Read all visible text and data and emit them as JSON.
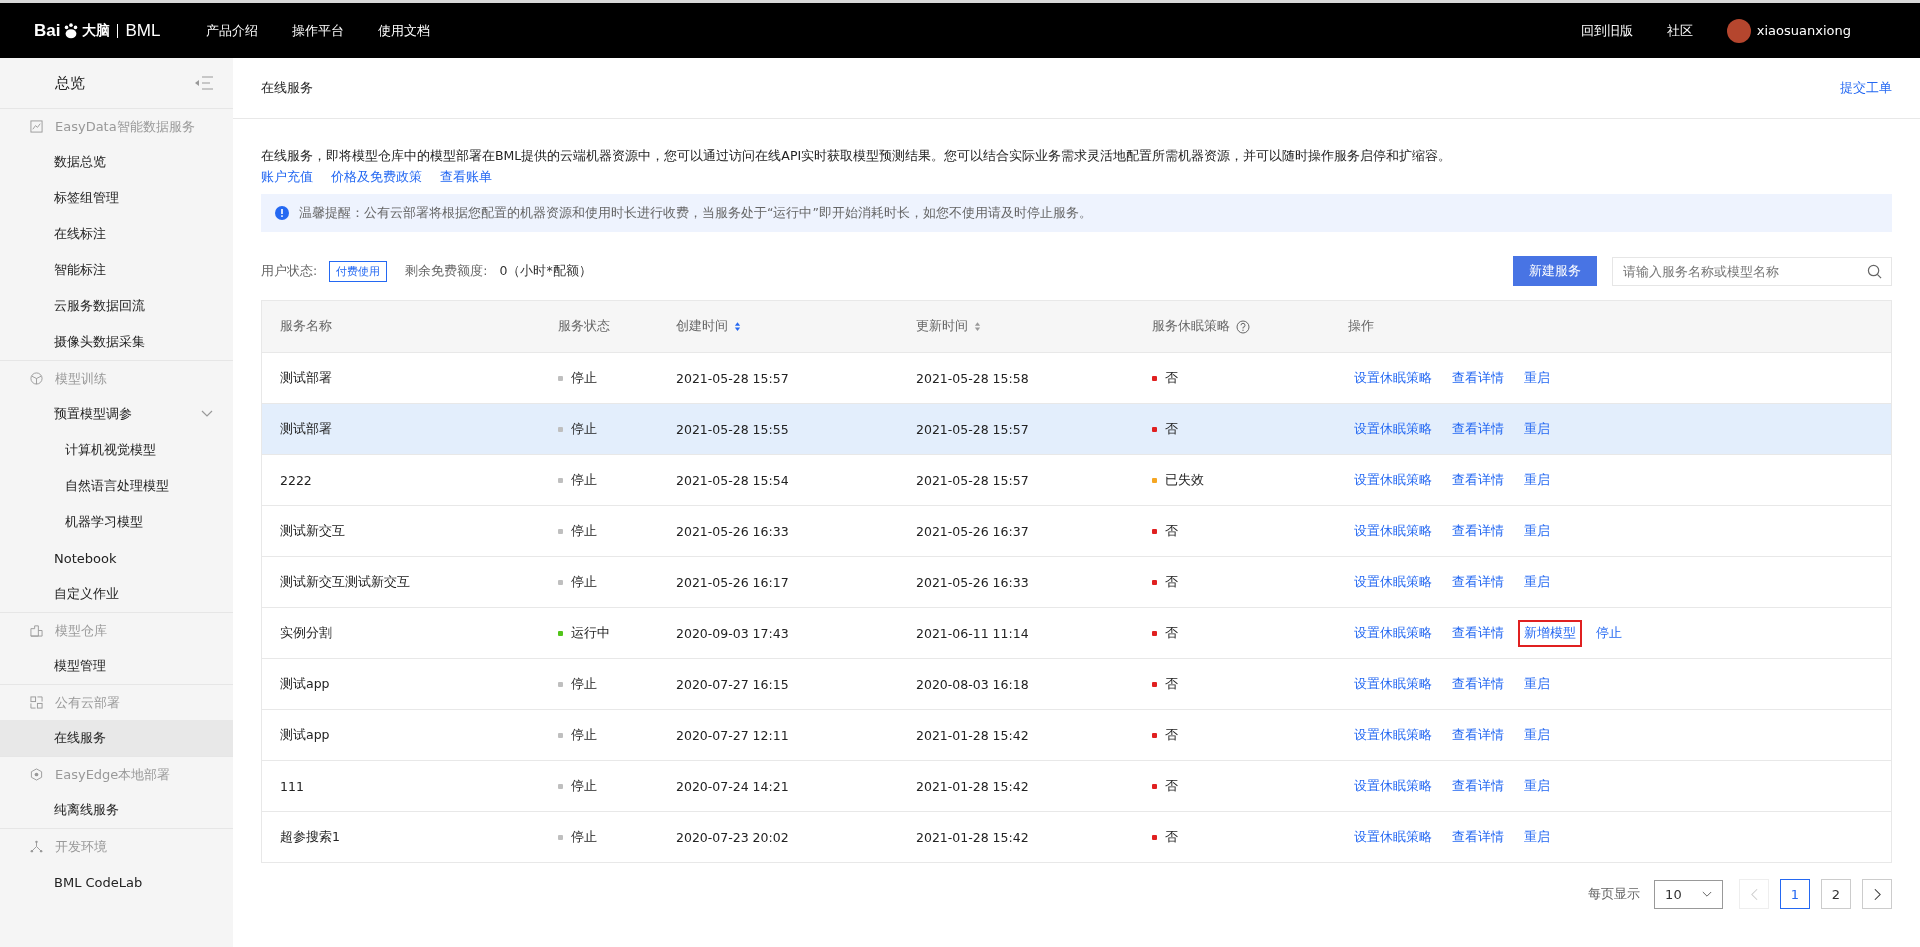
{
  "top_nav": {
    "logo_text": "Bai",
    "logo_suffix": "大脑",
    "logo_product": "BML",
    "links": [
      "产品介绍",
      "操作平台",
      "使用文档"
    ],
    "right_links": [
      "回到旧版",
      "社区"
    ],
    "username": "xiaosuanxiong"
  },
  "sidebar": {
    "title": "总览",
    "items": [
      {
        "kind": "section",
        "label": "EasyData智能数据服务"
      },
      {
        "kind": "item",
        "label": "数据总览",
        "selected": false
      },
      {
        "kind": "item",
        "label": "标签组管理",
        "selected": false
      },
      {
        "kind": "item",
        "label": "在线标注",
        "selected": false
      },
      {
        "kind": "item",
        "label": "智能标注",
        "selected": false
      },
      {
        "kind": "item",
        "label": "云服务数据回流",
        "selected": false
      },
      {
        "kind": "item",
        "label": "摄像头数据采集",
        "selected": false
      },
      {
        "kind": "section",
        "label": "模型训练"
      },
      {
        "kind": "group",
        "label": "预置模型调参",
        "expanded": true,
        "children": [
          {
            "label": "计算机视觉模型",
            "selected": false
          },
          {
            "label": "自然语言处理模型",
            "selected": false
          },
          {
            "label": "机器学习模型",
            "selected": false
          }
        ]
      },
      {
        "kind": "item",
        "label": "Notebook",
        "selected": false
      },
      {
        "kind": "item",
        "label": "自定义作业",
        "selected": false
      },
      {
        "kind": "section",
        "label": "模型仓库"
      },
      {
        "kind": "item",
        "label": "模型管理",
        "selected": false
      },
      {
        "kind": "section",
        "label": "公有云部署"
      },
      {
        "kind": "item",
        "label": "在线服务",
        "selected": true
      },
      {
        "kind": "section",
        "label": "EasyEdge本地部署"
      },
      {
        "kind": "item",
        "label": "纯离线服务",
        "selected": false
      },
      {
        "kind": "section",
        "label": "开发环境"
      },
      {
        "kind": "item",
        "label": "BML CodeLab",
        "selected": false
      }
    ]
  },
  "page_header": {
    "title": "在线服务",
    "ticket_link": "提交工单"
  },
  "description": "在线服务，即将模型仓库中的模型部署在BML提供的云端机器资源中，您可以通过访问在线API实时获取模型预测结果。您可以结合实际业务需求灵活地配置所需机器资源，并可以随时操作服务启停和扩缩容。",
  "desc_links": [
    "账户充值",
    "价格及免费政策",
    "查看账单"
  ],
  "alert": "温馨提醒：公有云部署将根据您配置的机器资源和使用时长进行收费，当服务处于“运行中”即开始消耗时长，如您不使用请及时停止服务。",
  "user_status": {
    "label": "用户状态:",
    "tag": "付费使用",
    "quota_label": "剩余免费额度:",
    "quota_value": "0（小时*配额）"
  },
  "new_button": "新建服务",
  "search": {
    "placeholder": "请输入服务名称或模型名称"
  },
  "table": {
    "columns": [
      {
        "label": "服务名称",
        "sortable": false,
        "help": false
      },
      {
        "label": "服务状态",
        "sortable": false,
        "help": false
      },
      {
        "label": "创建时间",
        "sortable": true,
        "help": false
      },
      {
        "label": "更新时间",
        "sortable": true,
        "help": false
      },
      {
        "label": "服务休眠策略",
        "sortable": false,
        "help": true
      },
      {
        "label": "操作",
        "sortable": false,
        "help": false
      }
    ],
    "rows": [
      {
        "name": "测试部署",
        "status": {
          "text": "停止",
          "color": "#bfbfbf"
        },
        "created": "2021-05-28 15:57",
        "updated": "2021-05-28 15:58",
        "sleep": {
          "text": "否",
          "color": "#e02020"
        },
        "selected": false,
        "actions": [
          {
            "label": "设置休眠策略",
            "annotated": false
          },
          {
            "label": "查看详情",
            "annotated": false
          },
          {
            "label": "重启",
            "annotated": false
          }
        ]
      },
      {
        "name": "测试部署",
        "status": {
          "text": "停止",
          "color": "#bfbfbf"
        },
        "created": "2021-05-28 15:55",
        "updated": "2021-05-28 15:57",
        "sleep": {
          "text": "否",
          "color": "#e02020"
        },
        "selected": true,
        "actions": [
          {
            "label": "设置休眠策略",
            "annotated": false
          },
          {
            "label": "查看详情",
            "annotated": false
          },
          {
            "label": "重启",
            "annotated": false
          }
        ]
      },
      {
        "name": "2222",
        "status": {
          "text": "停止",
          "color": "#bfbfbf"
        },
        "created": "2021-05-28 15:54",
        "updated": "2021-05-28 15:57",
        "sleep": {
          "text": "已失效",
          "color": "#f5a623"
        },
        "selected": false,
        "actions": [
          {
            "label": "设置休眠策略",
            "annotated": false
          },
          {
            "label": "查看详情",
            "annotated": false
          },
          {
            "label": "重启",
            "annotated": false
          }
        ]
      },
      {
        "name": "测试新交互",
        "status": {
          "text": "停止",
          "color": "#bfbfbf"
        },
        "created": "2021-05-26 16:33",
        "updated": "2021-05-26 16:37",
        "sleep": {
          "text": "否",
          "color": "#e02020"
        },
        "selected": false,
        "actions": [
          {
            "label": "设置休眠策略",
            "annotated": false
          },
          {
            "label": "查看详情",
            "annotated": false
          },
          {
            "label": "重启",
            "annotated": false
          }
        ]
      },
      {
        "name": "测试新交互测试新交互",
        "status": {
          "text": "停止",
          "color": "#bfbfbf"
        },
        "created": "2021-05-26 16:17",
        "updated": "2021-05-26 16:33",
        "sleep": {
          "text": "否",
          "color": "#e02020"
        },
        "selected": false,
        "actions": [
          {
            "label": "设置休眠策略",
            "annotated": false
          },
          {
            "label": "查看详情",
            "annotated": false
          },
          {
            "label": "重启",
            "annotated": false
          }
        ]
      },
      {
        "name": "实例分割",
        "status": {
          "text": "运行中",
          "color": "#52c41a"
        },
        "created": "2020-09-03 17:43",
        "updated": "2021-06-11 11:14",
        "sleep": {
          "text": "否",
          "color": "#e02020"
        },
        "selected": false,
        "actions": [
          {
            "label": "设置休眠策略",
            "annotated": false
          },
          {
            "label": "查看详情",
            "annotated": false
          },
          {
            "label": "新增模型",
            "annotated": true
          },
          {
            "label": "停止",
            "annotated": false
          }
        ]
      },
      {
        "name": "测试app",
        "status": {
          "text": "停止",
          "color": "#bfbfbf"
        },
        "created": "2020-07-27 16:15",
        "updated": "2020-08-03 16:18",
        "sleep": {
          "text": "否",
          "color": "#e02020"
        },
        "selected": false,
        "actions": [
          {
            "label": "设置休眠策略",
            "annotated": false
          },
          {
            "label": "查看详情",
            "annotated": false
          },
          {
            "label": "重启",
            "annotated": false
          }
        ]
      },
      {
        "name": "测试app",
        "status": {
          "text": "停止",
          "color": "#bfbfbf"
        },
        "created": "2020-07-27 12:11",
        "updated": "2021-01-28 15:42",
        "sleep": {
          "text": "否",
          "color": "#e02020"
        },
        "selected": false,
        "actions": [
          {
            "label": "设置休眠策略",
            "annotated": false
          },
          {
            "label": "查看详情",
            "annotated": false
          },
          {
            "label": "重启",
            "annotated": false
          }
        ]
      },
      {
        "name": "111",
        "status": {
          "text": "停止",
          "color": "#bfbfbf"
        },
        "created": "2020-07-24 14:21",
        "updated": "2021-01-28 15:42",
        "sleep": {
          "text": "否",
          "color": "#e02020"
        },
        "selected": false,
        "actions": [
          {
            "label": "设置休眠策略",
            "annotated": false
          },
          {
            "label": "查看详情",
            "annotated": false
          },
          {
            "label": "重启",
            "annotated": false
          }
        ]
      },
      {
        "name": "超参搜索1",
        "status": {
          "text": "停止",
          "color": "#bfbfbf"
        },
        "created": "2020-07-23 20:02",
        "updated": "2021-01-28 15:42",
        "sleep": {
          "text": "否",
          "color": "#e02020"
        },
        "selected": false,
        "actions": [
          {
            "label": "设置休眠策略",
            "annotated": false
          },
          {
            "label": "查看详情",
            "annotated": false
          },
          {
            "label": "重启",
            "annotated": false
          }
        ]
      }
    ]
  },
  "pagination": {
    "page_size_label": "每页显示",
    "page_size": "10",
    "prev_disabled": true,
    "pages": [
      {
        "label": "1",
        "selected": true
      },
      {
        "label": "2",
        "selected": false
      }
    ],
    "next_disabled": false
  }
}
